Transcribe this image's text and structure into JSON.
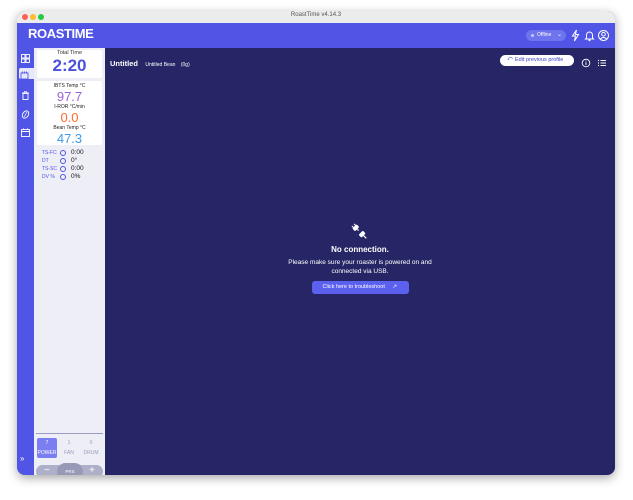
{
  "window": {
    "title": "RoastTime v4.14.3"
  },
  "app": {
    "logo": "ROASTIME"
  },
  "topbar": {
    "status": "Offline"
  },
  "panel": {
    "total_time_label": "Total Time",
    "total_time_value": "2:20",
    "ibts_label": "IBTS Temp °C",
    "ibts_value": "97.7",
    "ror_label": "I-ROR °C/min",
    "ror_value": "0.0",
    "bean_label": "Bean Temp °C",
    "bean_value": "47.3",
    "stats": [
      {
        "key": "TS-FC",
        "value": "0:00"
      },
      {
        "key": "DT",
        "value": "0°"
      },
      {
        "key": "TS-SC",
        "value": "0:00"
      },
      {
        "key": "DV %",
        "value": "0%"
      }
    ],
    "controls": [
      {
        "value": "7",
        "label": "POWER"
      },
      {
        "value": "1",
        "label": "FAN"
      },
      {
        "value": "0",
        "label": "DRUM"
      }
    ],
    "stepper": {
      "minus": "−",
      "center": "PRS",
      "plus": "+"
    },
    "expand": "»"
  },
  "main": {
    "title": "Untitled",
    "subtitle": "Untitled Bean",
    "weight": "(0g)",
    "edit_button": "Edit previous profile",
    "empty_title": "No connection.",
    "empty_line1": "Please make sure your roaster is powered on and",
    "empty_line2": "connected via USB.",
    "troubleshoot": "Click here to troubleshoot"
  },
  "colors": {
    "brand": "#5055e6",
    "main_bg": "#262666",
    "ibts": "#9b63d6",
    "ror": "#ff6a2b",
    "bean": "#3d9be8"
  }
}
